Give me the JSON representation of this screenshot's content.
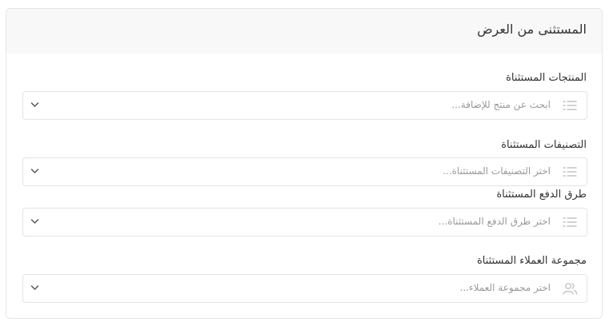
{
  "card": {
    "title": "المستثنى من العرض"
  },
  "fields": [
    {
      "label": "المنتجات المستثناة",
      "placeholder": "ابحث عن منتج للإضافة...",
      "icon": "list-icon"
    },
    {
      "label": "التصنيفات المستثناة",
      "placeholder": "اختر التصنيفات المستثناة...",
      "icon": "list-icon"
    },
    {
      "label": "طرق الدفع المستثناة",
      "placeholder": "اختر طرق الدفع المستثناة...",
      "icon": "list-icon"
    },
    {
      "label": "مجموعة العملاء المستثناة",
      "placeholder": "اختر مجموعة العملاء...",
      "icon": "users-icon"
    }
  ],
  "colors": {
    "header_bg": "#f8f8f8",
    "border": "#e3e3e3",
    "placeholder": "#9a9a9a",
    "icon": "#c4c4c4"
  }
}
